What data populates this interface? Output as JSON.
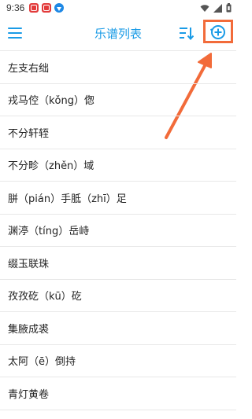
{
  "status_bar": {
    "time": "9:36",
    "notification_icons": [
      "red-app-icon",
      "red-app-icon",
      "blue-download-icon"
    ],
    "right_icons": [
      "wifi-icon",
      "signal-icon",
      "battery-icon"
    ]
  },
  "header": {
    "title": "乐谱列表",
    "accent_color": "#1a9be6"
  },
  "annotation": {
    "highlight_color": "#f26b3a"
  },
  "list": {
    "items": [
      "左支右绌",
      "戎马倥（kǒng）偬",
      "不分轩轾",
      "不分畛（zhěn）域",
      "胼（pián）手胝（zhī）足",
      "渊渟（tíng）岳峙",
      "缀玉联珠",
      "孜孜矻（kū）矻",
      "集腋成裘",
      "太阿（ē）倒持",
      "青灯黄卷"
    ]
  }
}
